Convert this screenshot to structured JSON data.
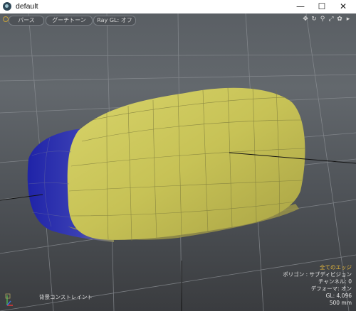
{
  "window": {
    "title": "default",
    "minimize_symbol": "—",
    "maximize_symbol": "☐",
    "close_symbol": "✕"
  },
  "viewport": {
    "toolbar": {
      "view_mode": "パース",
      "shading_mode": "グーチトーン",
      "raygl": "Ray GL: オフ"
    },
    "nav_icons": [
      "move-view-icon",
      "rotate-view-icon",
      "zoom-view-icon",
      "fit-view-icon",
      "settings-icon",
      "expand-arrow-icon"
    ],
    "background_label": "背景コンストレイント",
    "stats": {
      "selection": "全てのエッジ",
      "polygons": "ポリゴン : サブディビジョン",
      "channels": "チャンネル: 0",
      "deformers": "デフォーマ: オン",
      "gl": "GL: 4,096",
      "scale": "500 mm"
    }
  },
  "colors": {
    "mesh_yellow": "#c8c256",
    "mesh_blue": "#2a2fb0",
    "highlight": "#e6b93c"
  }
}
